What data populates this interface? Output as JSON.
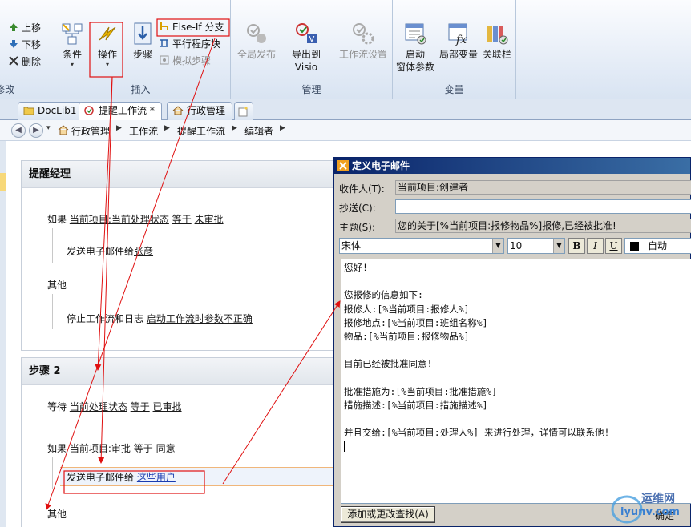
{
  "ribbon": {
    "edit_group": {
      "move_up": "上移",
      "move_down": "下移",
      "delete": "删除",
      "group_label_partial": "修改"
    },
    "insert_group": {
      "condition": "条件",
      "action": "操作",
      "step": "步骤",
      "else_if": "Else-If 分支",
      "parallel": "平行程序块",
      "impersonation": "模拟步骤",
      "group_label": "插入"
    },
    "manage_group": {
      "publish_globally": "全局发布",
      "export_visio": "导出到 Visio",
      "workflow_settings": "工作流设置",
      "group_label": "管理"
    },
    "variables_group": {
      "initiation_form_params_line1": "启动",
      "initiation_form_params_line2": "窗体参数",
      "local_variables": "局部变量",
      "association_columns": "关联栏",
      "group_label": "变量"
    }
  },
  "tabs": [
    {
      "label": "DocLib1"
    },
    {
      "label": "提醒工作流 *"
    },
    {
      "label": "行政管理"
    }
  ],
  "breadcrumb": [
    "行政管理",
    "工作流",
    "提醒工作流",
    "编辑者"
  ],
  "designer": {
    "step1": {
      "title": "提醒经理",
      "if_kw": "如果",
      "if_field": "当前项目:当前处理状态",
      "if_op": "等于",
      "if_value": "未审批",
      "then_action": "发送电子邮件给",
      "then_target": "张彦",
      "else_kw": "其他",
      "else_action": "停止工作流和日志",
      "else_target": "启动工作流时参数不正确"
    },
    "step2": {
      "title": "步骤 2",
      "wait_kw": "等待",
      "wait_field": "当前处理状态",
      "wait_op": "等于",
      "wait_value": "已审批",
      "if_kw": "如果",
      "if_field": "当前项目:审批",
      "if_op": "等于",
      "if_value": "同意",
      "then_action": "发送电子邮件给",
      "then_target": "这些用户",
      "else_kw": "其他"
    }
  },
  "dialog": {
    "title": "定义电子邮件",
    "to_label": "收件人(T):",
    "to_value": "当前项目:创建者",
    "cc_label": "抄送(C):",
    "cc_value": "",
    "subject_label": "主题(S):",
    "subject_value": "您的关于[%当前项目:报修物品%]报修,已经被批准!",
    "font_name": "宋体",
    "font_size": "10",
    "bold": "B",
    "italic": "I",
    "underline": "U",
    "color_label": "自动",
    "body_lines": [
      "您好!",
      "",
      "您报修的信息如下:",
      "报修人:[%当前项目:报修人%]",
      "报修地点:[%当前项目:班组名称%]",
      "物品:[%当前项目:报修物品%]",
      "",
      "目前已经被批准同意!",
      "",
      "批准措施为:[%当前项目:批准措施%]",
      "措施描述:[%当前项目:措施描述%]",
      "",
      "并且交给:[%当前项目:处理人%] 来进行处理，详情可以联系他!"
    ],
    "lookup_button": "添加或更改查找(A)",
    "ok_button": "确定"
  },
  "watermark": {
    "cn": "运维网",
    "en": "iyunv.com"
  },
  "colors": {
    "annotation": "#e01010",
    "dialog_title": "#0a246a",
    "link": "#1a3bb0"
  }
}
